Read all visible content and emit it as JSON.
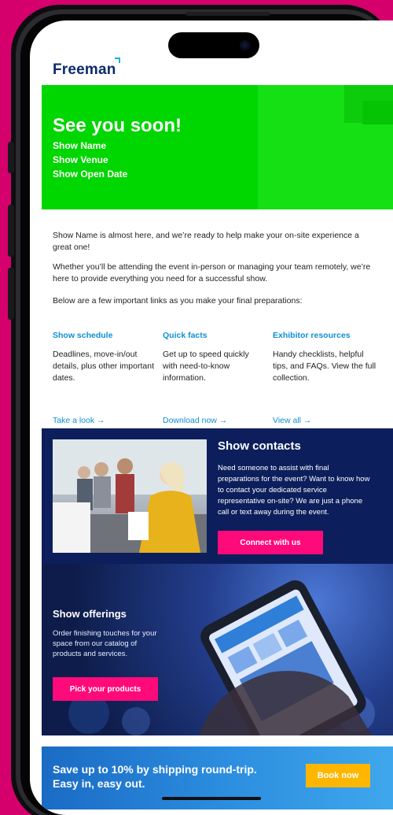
{
  "brand": {
    "logo_text": "Freeman"
  },
  "hero": {
    "title": "See you soon!",
    "show_name": "Show Name",
    "show_venue": "Show Venue",
    "show_open_date": "Show Open Date",
    "color": "#00d600"
  },
  "intro": {
    "p1": "Show Name is almost here, and we’re ready to help make your on-site experience a great one!",
    "p2": "Whether you’ll be attending the event in-person or managing your team remotely, we’re here to provide everything you need for a successful show.",
    "p3": "Below are a few important links as you make your final preparations:"
  },
  "links": [
    {
      "title": "Show schedule",
      "desc": "Deadlines, move-in/out details, plus other important dates.",
      "cta": "Take a look →"
    },
    {
      "title": "Quick facts",
      "desc": "Get up to speed quickly with need-to-know information.",
      "cta": "Download now →"
    },
    {
      "title": "Exhibitor resources",
      "desc": "Handy checklists, helpful tips, and FAQs. View the full collection.",
      "cta": "View all →"
    }
  ],
  "contacts": {
    "title": "Show contacts",
    "body": "Need someone to assist with final preparations for the event? Want to know how to contact your dedicated service representative on-site? We are just a phone call or text away during the event.",
    "button": "Connect with us"
  },
  "offerings": {
    "title": "Show offerings",
    "body": "Order finishing touches for your space from our catalog of products and services.",
    "button": "Pick your products"
  },
  "banner": {
    "line1": "Save up to 10% by shipping round-trip.",
    "line2": "Easy in, easy out.",
    "button": "Book now"
  },
  "colors": {
    "accent_pink": "#ff0a7a",
    "navy": "#0c1f5c",
    "link_blue": "#0f8fd6",
    "cta_yellow": "#ffb600",
    "background": "#d6006d"
  }
}
